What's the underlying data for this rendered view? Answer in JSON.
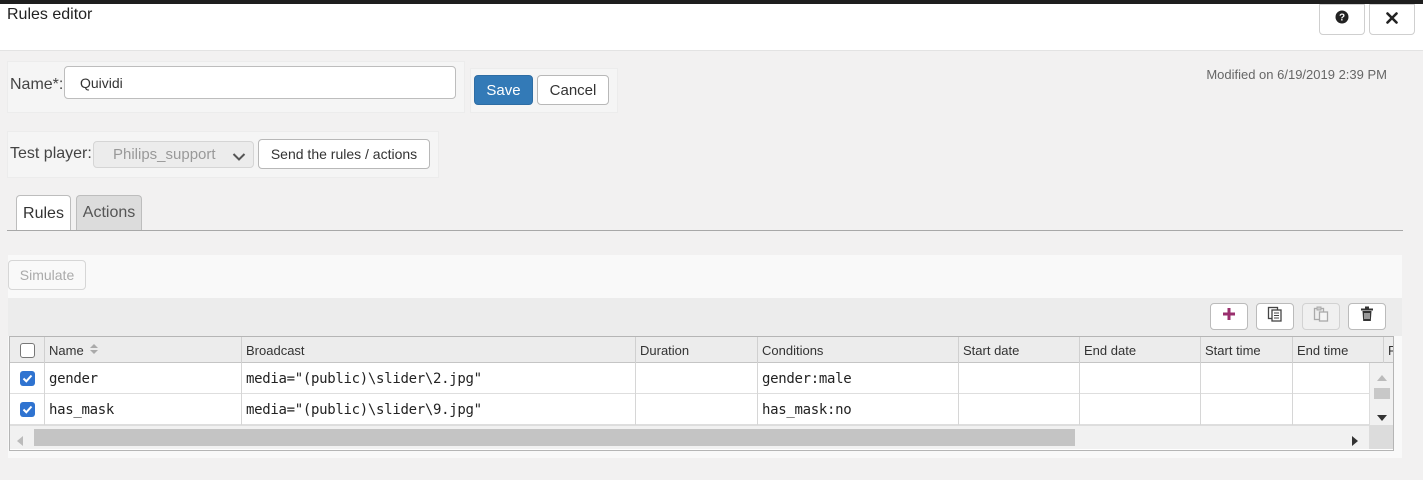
{
  "window": {
    "title": "Rules editor",
    "help_icon": "question-circle-icon",
    "close_icon": "close-x-icon"
  },
  "form": {
    "name_label": "Name*:",
    "name_value": "Quividi",
    "save_label": "Save",
    "cancel_label": "Cancel",
    "modified_text": "Modified on 6/19/2019 2:39 PM",
    "test_player_label": "Test player:",
    "test_player_value": "Philips_support",
    "send_label": "Send the rules / actions"
  },
  "tabs": [
    {
      "label": "Rules",
      "active": true
    },
    {
      "label": "Actions",
      "active": false
    }
  ],
  "simulate_label": "Simulate",
  "toolbar": {
    "icons": [
      "add-plus-icon",
      "copy-icon",
      "paste-icon",
      "trash-icon"
    ],
    "add_color": "#9a2f6e"
  },
  "grid": {
    "columns": [
      "Name",
      "Broadcast",
      "Duration",
      "Conditions",
      "Start date",
      "End date",
      "Start time",
      "End time",
      "P"
    ],
    "rows": [
      {
        "checked": true,
        "name": "gender",
        "broadcast": "media=\"(public)\\slider\\2.jpg\"",
        "duration": "",
        "conditions": "gender:male",
        "start_date": "",
        "end_date": "",
        "start_time": "",
        "end_time": ""
      },
      {
        "checked": true,
        "name": "has_mask",
        "broadcast": "media=\"(public)\\slider\\9.jpg\"",
        "duration": "",
        "conditions": "has_mask:no",
        "start_date": "",
        "end_date": "",
        "start_time": "",
        "end_time": ""
      }
    ]
  },
  "colors": {
    "primary": "#337ab7",
    "checkbox": "#2f73d0",
    "background": "#f2f1f1"
  }
}
